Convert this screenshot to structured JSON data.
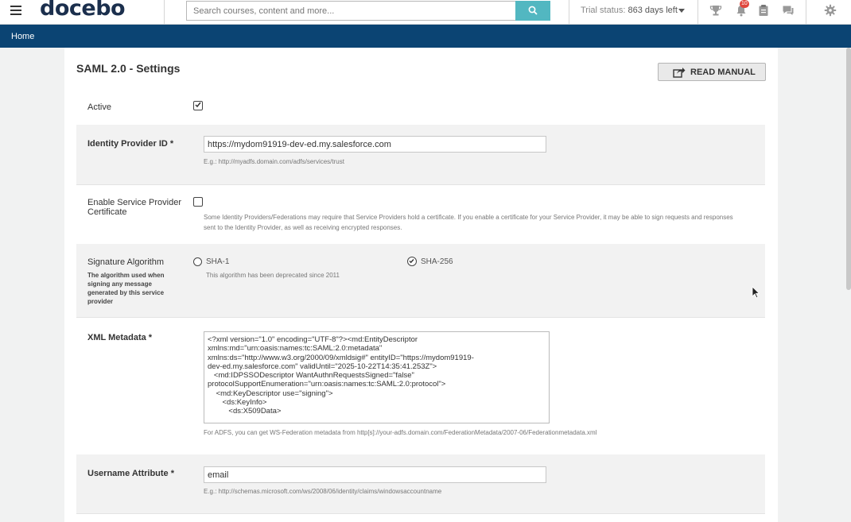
{
  "header": {
    "logo": "docebo",
    "logo_mark": "®",
    "search_placeholder": "Search courses, content and more...",
    "trial_label": "Trial status:",
    "trial_days": "863 days left",
    "notification_count": "10"
  },
  "nav": {
    "home": "Home"
  },
  "page": {
    "title": "SAML 2.0 - Settings",
    "read_manual": "READ MANUAL"
  },
  "form": {
    "active": {
      "label": "Active",
      "checked": true
    },
    "idp_id": {
      "label": "Identity Provider ID *",
      "value": "https://mydom91919-dev-ed.my.salesforce.com",
      "hint": "E.g.: http://myadfs.domain.com/adfs/services/trust"
    },
    "sp_cert": {
      "label": "Enable Service Provider Certificate",
      "checked": false,
      "hint_line1": "Some Identity Providers/Federations may require that Service Providers hold a certificate. If you enable a certificate for your Service Provider, it may be able to sign requests and responses",
      "hint_line2": "sent to the Identity Provider, as well as receiving encrypted responses."
    },
    "sig_alg": {
      "label": "Signature Algorithm",
      "help": "The algorithm used when signing any message generated by this service provider",
      "option1": "SHA-1",
      "option1_note": "This algorithm has been deprecated since 2011",
      "option2": "SHA-256",
      "selected": "SHA-256"
    },
    "xml": {
      "label": "XML Metadata *",
      "value": "<?xml version=\"1.0\" encoding=\"UTF-8\"?><md:EntityDescriptor\nxmlns:md=\"urn:oasis:names:tc:SAML:2.0:metadata\"\nxmlns:ds=\"http://www.w3.org/2000/09/xmldsig#\" entityID=\"https://mydom91919-\ndev-ed.my.salesforce.com\" validUntil=\"2025-10-22T14:35:41.253Z\">\n   <md:IDPSSODescriptor WantAuthnRequestsSigned=\"false\"\nprotocolSupportEnumeration=\"urn:oasis:names:tc:SAML:2.0:protocol\">\n    <md:KeyDescriptor use=\"signing\">\n       <ds:KeyInfo>\n          <ds:X509Data>",
      "hint": "For ADFS, you can get WS-Federation metadata from http[s]://your-adfs.domain.com/FederationMetadata/2007-06/Federationmetadata.xml"
    },
    "username": {
      "label": "Username Attribute *",
      "value": "email",
      "hint": "E.g.: http://schemas.microsoft.com/ws/2008/06/identity/claims/windowsaccountname"
    }
  },
  "icons": {
    "menu": "hamburger-icon",
    "search": "search-icon",
    "trophy": "trophy-icon",
    "bell": "bell-icon",
    "clipboard": "clipboard-icon",
    "chat": "chat-icon",
    "gear": "gear-icon",
    "share": "share-icon"
  },
  "colors": {
    "navbar": "#0b4473",
    "search_button": "#52b7c1",
    "logo": "#1b2f4d",
    "badge": "#e0463c"
  }
}
